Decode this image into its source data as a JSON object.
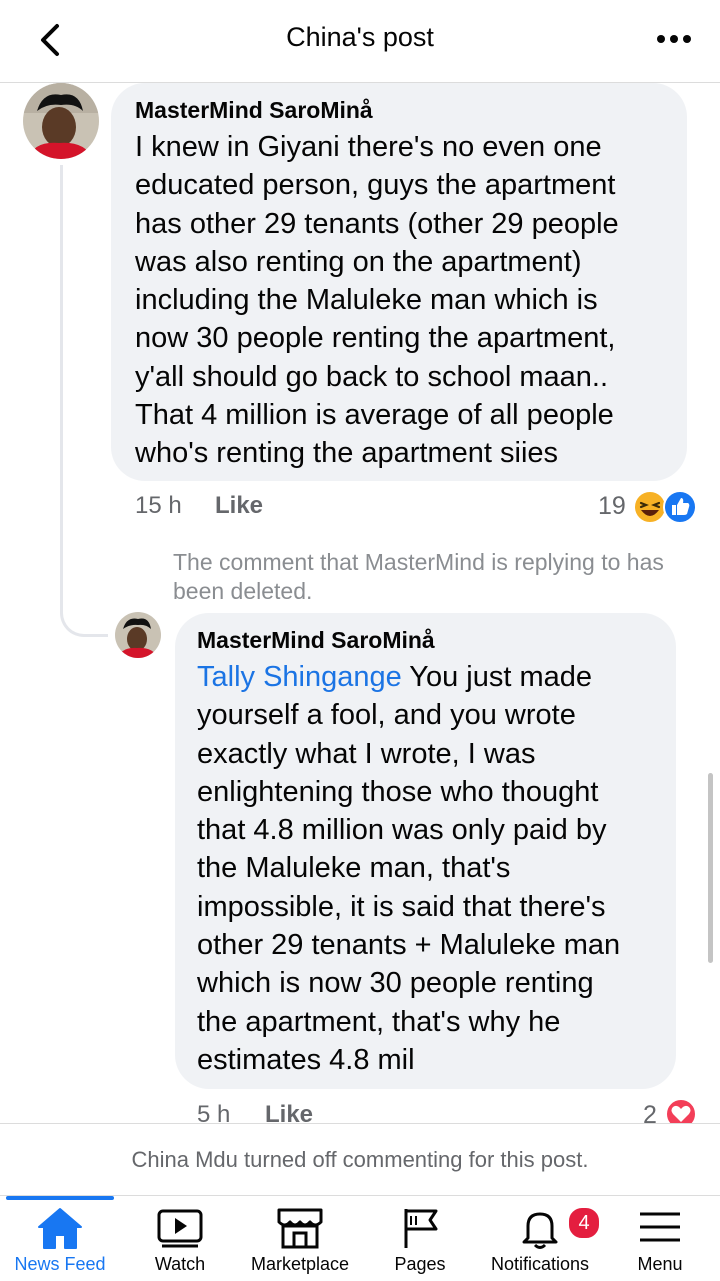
{
  "header": {
    "title": "China's post"
  },
  "comments": [
    {
      "author": "MasterMind SaroMinå",
      "lines": [
        "I knew in Giyani there's no even one",
        "educated person, guys the apartment",
        "has other 29 tenants (other 29 people",
        "was also renting on the apartment)",
        "including the Maluleke man which is",
        "now 30 people renting the apartment,",
        "y'all should go back to school maan..",
        "That 4 million is average of all people",
        "who's renting the apartment siies"
      ],
      "time": "15 h",
      "like_label": "Like",
      "reaction_count": "19",
      "reaction_icons": [
        "haha-icon",
        "like-icon"
      ]
    },
    {
      "deleted_notice": "The comment that MasterMind is replying to has been deleted.",
      "author": "MasterMind SaroMinå",
      "mention": "Tally Shingange",
      "first_line_rest": " You just made",
      "lines": [
        "yourself a fool, and you wrote",
        "exactly what I wrote, I was",
        "enlightening those who thought",
        "that 4.8 million was only paid by",
        "the Maluleke man, that's",
        "impossible, it is said that there's",
        "other 29 tenants + Maluleke man",
        "which is now 30 people renting",
        "the apartment, that's why he",
        "estimates 4.8 mil"
      ],
      "time": "5 h",
      "like_label": "Like",
      "reaction_count": "2",
      "reaction_icons": [
        "love-icon"
      ]
    }
  ],
  "commenting_notice": "China Mdu turned off commenting for this post.",
  "tabs": [
    {
      "label": "News Feed",
      "icon": "home-icon",
      "active": true
    },
    {
      "label": "Watch",
      "icon": "watch-icon"
    },
    {
      "label": "Marketplace",
      "icon": "marketplace-icon"
    },
    {
      "label": "Pages",
      "icon": "flag-icon"
    },
    {
      "label": "Notifications",
      "icon": "bell-icon",
      "badge": "4"
    },
    {
      "label": "Menu",
      "icon": "menu-icon"
    }
  ],
  "colors": {
    "accent": "#1877f2",
    "mention": "#1b74e4",
    "bubble": "#f0f2f5",
    "badge": "#e41e3f"
  }
}
